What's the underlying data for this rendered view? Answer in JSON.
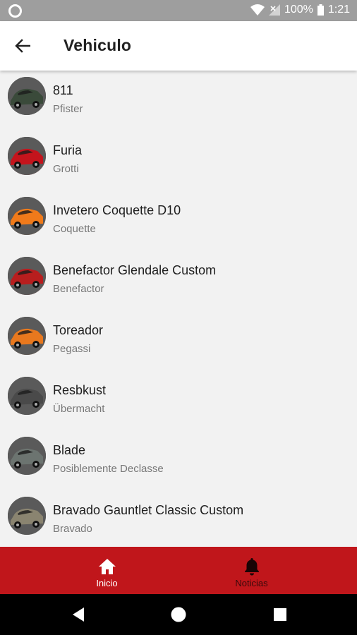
{
  "status_bar": {
    "battery": "100%",
    "time": "1:21"
  },
  "app_bar": {
    "title": "Vehiculo",
    "back_icon": "arrow-back-icon"
  },
  "vehicles": [
    {
      "name": "811",
      "maker": "Pfister",
      "color": "#3a4a3a"
    },
    {
      "name": "Furia",
      "maker": "Grotti",
      "color": "#c4141c"
    },
    {
      "name": "Invetero Coquette D10",
      "maker": "Coquette",
      "color": "#f07a1a"
    },
    {
      "name": "Benefactor Glendale Custom",
      "maker": "Benefactor",
      "color": "#b81e1e"
    },
    {
      "name": "Toreador",
      "maker": "Pegassi",
      "color": "#e8781e"
    },
    {
      "name": "Resbkust",
      "maker": "Übermacht",
      "color": "#4a4a4a"
    },
    {
      "name": "Blade",
      "maker": "Posiblemente Declasse",
      "color": "#6c7470"
    },
    {
      "name": "Bravado Gauntlet Classic Custom",
      "maker": "Bravado",
      "color": "#8a8470"
    }
  ],
  "bottom_nav": {
    "tabs": [
      {
        "label": "Inicio",
        "icon": "home-icon",
        "active": true
      },
      {
        "label": "Noticias",
        "icon": "bell-icon",
        "active": false
      }
    ],
    "background": "#c0161b"
  }
}
